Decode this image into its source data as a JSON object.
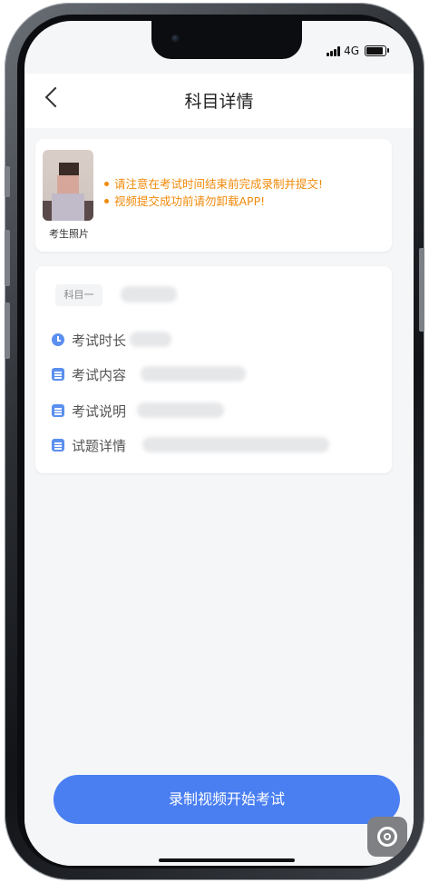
{
  "status_bar": {
    "network": "4G"
  },
  "navbar": {
    "title": "科目详情"
  },
  "candidate": {
    "photo_label": "考生照片",
    "notices": [
      "请注意在考试时间结束前完成录制并提交!",
      "视频提交成功前请勿卸载APP!"
    ],
    "notice_color": "#f08a0b"
  },
  "subject": {
    "tag": "科目一",
    "rows": [
      {
        "icon": "clock-icon",
        "label": "考试时长"
      },
      {
        "icon": "document-icon",
        "label": "考试内容"
      },
      {
        "icon": "document-icon",
        "label": "考试说明"
      },
      {
        "icon": "document-icon",
        "label": "试题详情"
      }
    ]
  },
  "actions": {
    "start_label": "录制视频开始考试"
  },
  "colors": {
    "accent": "#4a7ff2",
    "background": "#f5f6f8"
  }
}
